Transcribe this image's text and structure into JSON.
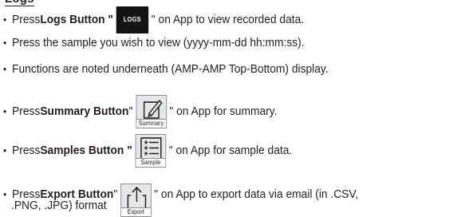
{
  "heading": "Logs",
  "steps": [
    {
      "pre": "Press ",
      "bold": "Logs Button \"",
      "icon": "logs-icon",
      "icon_label": "LOGS",
      "post": "\" on App to view recorded data."
    },
    {
      "text": "Press the sample you wish to view (yyyy-mm-dd hh:mm:ss)."
    },
    {
      "text": "Functions are noted underneath (AMP-AMP Top-Bottom) display."
    },
    {
      "pre": "Press ",
      "bold": "Summary Button",
      "mid": " \"",
      "icon": "pencil-edit-icon",
      "icon_label": "Summary",
      "post": "\" on App for summary."
    },
    {
      "pre": "Press ",
      "bold": "Samples Button \"",
      "icon": "list-icon",
      "icon_label": "Sample",
      "post": "\" on App for sample data."
    },
    {
      "pre": "Press ",
      "bold": "Export Button",
      "mid": " \"",
      "icon": "export-arrow-icon",
      "icon_label": "Export",
      "post": "\" on App to export data via email (in .CSV,",
      "continuation": ".PNG, .JPG) format"
    }
  ],
  "colors": {
    "text": "#231f20",
    "logs_icon_bg": "#131313",
    "icon_bg": "#e6e7e8",
    "icon_border": "#8a8c8e"
  }
}
